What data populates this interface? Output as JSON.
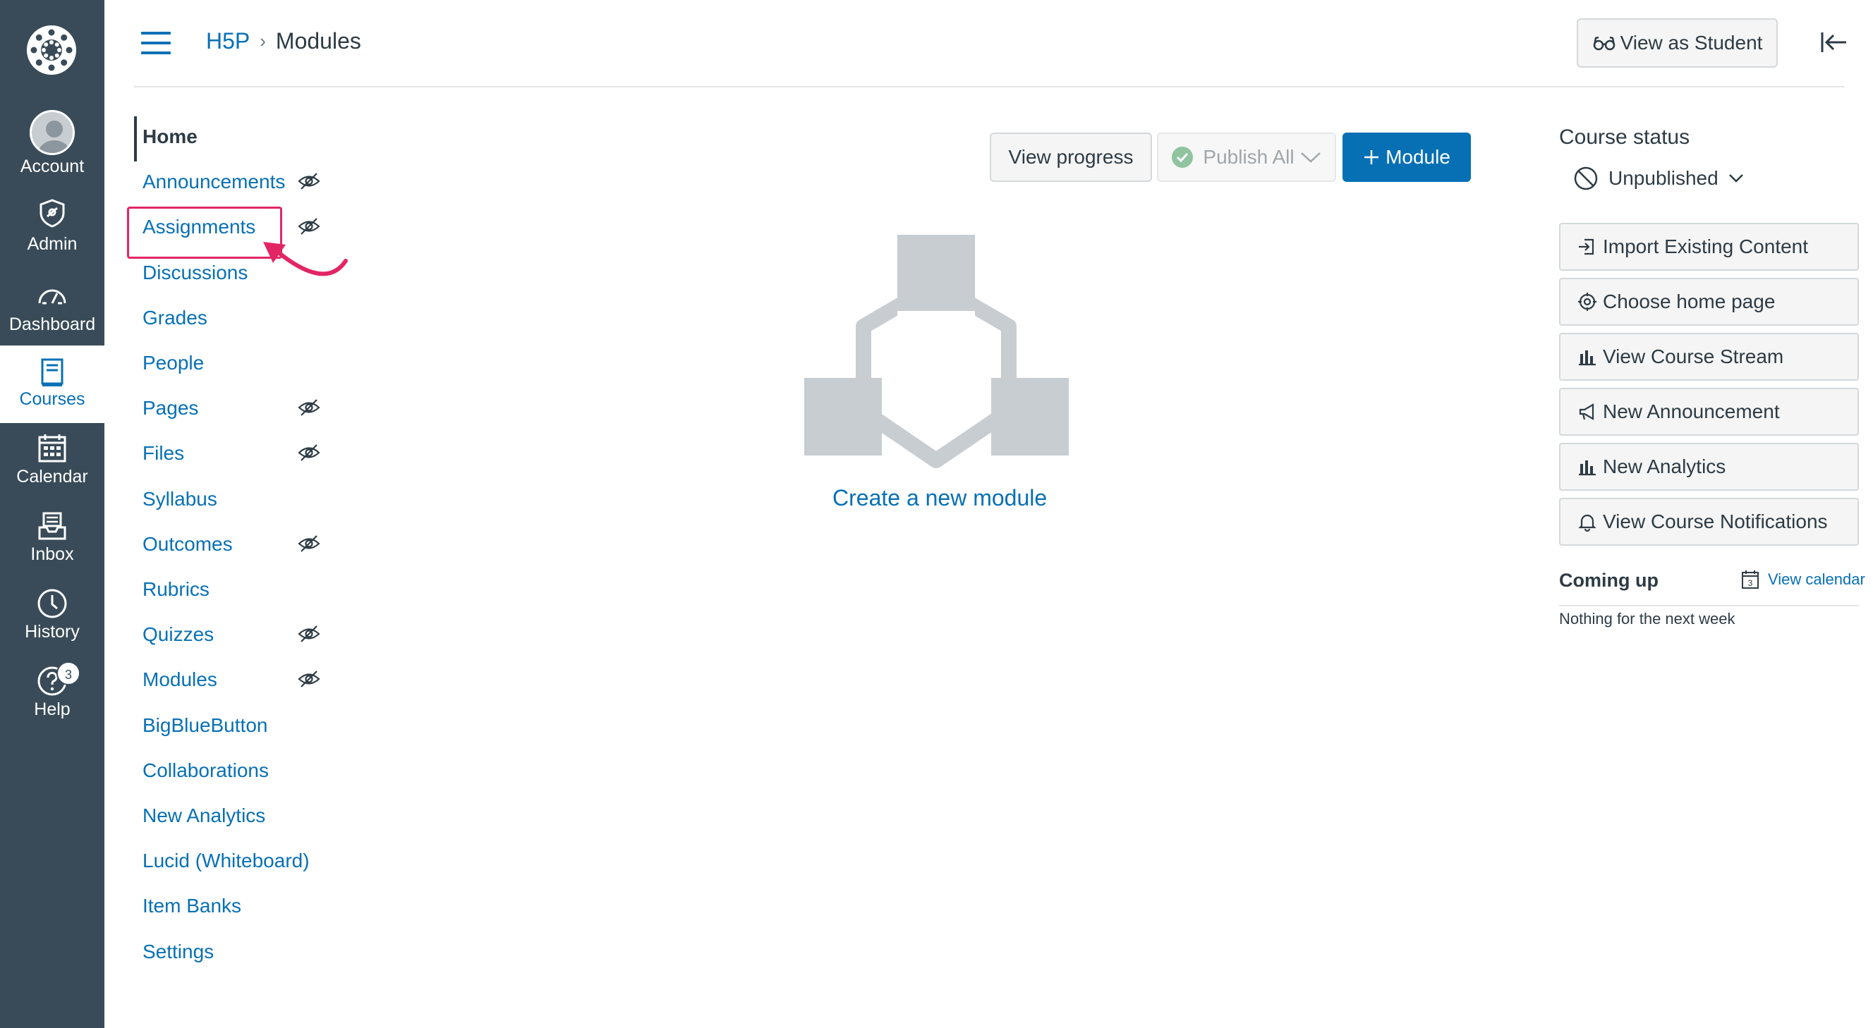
{
  "global_nav": {
    "items": [
      {
        "label": "Account"
      },
      {
        "label": "Admin"
      },
      {
        "label": "Dashboard"
      },
      {
        "label": "Courses"
      },
      {
        "label": "Calendar"
      },
      {
        "label": "Inbox"
      },
      {
        "label": "History"
      },
      {
        "label": "Help",
        "badge": "3"
      }
    ],
    "active": "Courses"
  },
  "header": {
    "breadcrumb": {
      "course": "H5P",
      "separator": "›",
      "current": "Modules"
    },
    "view_as_student": "View as Student"
  },
  "course_nav": {
    "items": [
      {
        "label": "Home",
        "hidden": false
      },
      {
        "label": "Announcements",
        "hidden": true
      },
      {
        "label": "Assignments",
        "hidden": true
      },
      {
        "label": "Discussions",
        "hidden": false
      },
      {
        "label": "Grades",
        "hidden": false
      },
      {
        "label": "People",
        "hidden": false
      },
      {
        "label": "Pages",
        "hidden": true
      },
      {
        "label": "Files",
        "hidden": true
      },
      {
        "label": "Syllabus",
        "hidden": false
      },
      {
        "label": "Outcomes",
        "hidden": true
      },
      {
        "label": "Rubrics",
        "hidden": false
      },
      {
        "label": "Quizzes",
        "hidden": true
      },
      {
        "label": "Modules",
        "hidden": true
      },
      {
        "label": "BigBlueButton",
        "hidden": false
      },
      {
        "label": "Collaborations",
        "hidden": false
      },
      {
        "label": "New Analytics",
        "hidden": false
      },
      {
        "label": "Lucid (Whiteboard)",
        "hidden": false
      },
      {
        "label": "Item Banks",
        "hidden": false
      },
      {
        "label": "Settings",
        "hidden": false
      }
    ],
    "highlighted": "Assignments"
  },
  "toolbar": {
    "view_progress": "View progress",
    "publish_all": "Publish All",
    "add_module": "Module"
  },
  "empty_state": {
    "create_link": "Create a new module"
  },
  "sidebar": {
    "course_status_title": "Course status",
    "status_value": "Unpublished",
    "buttons": [
      {
        "label": "Import Existing Content",
        "icon": "import-icon"
      },
      {
        "label": "Choose home page",
        "icon": "target-icon"
      },
      {
        "label": "View Course Stream",
        "icon": "bar-chart-icon"
      },
      {
        "label": "New Announcement",
        "icon": "megaphone-icon"
      },
      {
        "label": "New Analytics",
        "icon": "bar-chart-icon"
      },
      {
        "label": "View Course Notifications",
        "icon": "bell-icon"
      }
    ],
    "coming_up": "Coming up",
    "view_calendar": "View calendar",
    "calendar_day": "3",
    "nothing": "Nothing for the next week"
  },
  "colors": {
    "nav_bg": "#394b58",
    "link": "#0770b5",
    "primary_button": "#0770b5",
    "highlight": "#e22664",
    "illustration": "#c7cdd1"
  }
}
